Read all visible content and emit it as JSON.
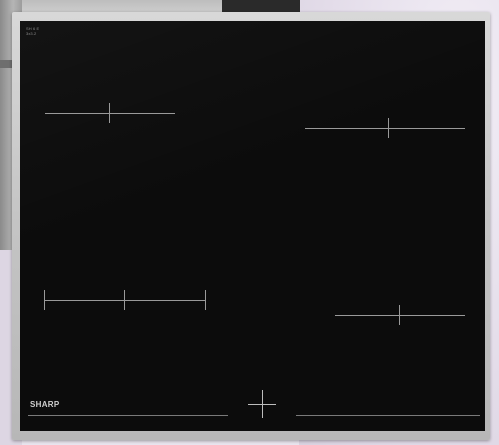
{
  "hob": {
    "brand": "SHARP",
    "spec_text": "SH 6 E\n3x3.2"
  },
  "colors": {
    "glass": "#0c0c0c",
    "frame": "#c8c8c8",
    "marker": "#9a9a9a"
  },
  "cooking_zones": [
    "front-left-zone",
    "rear-left-zone",
    "rear-right-zone",
    "front-right-zone"
  ],
  "controls": [
    "center-control-cross"
  ]
}
